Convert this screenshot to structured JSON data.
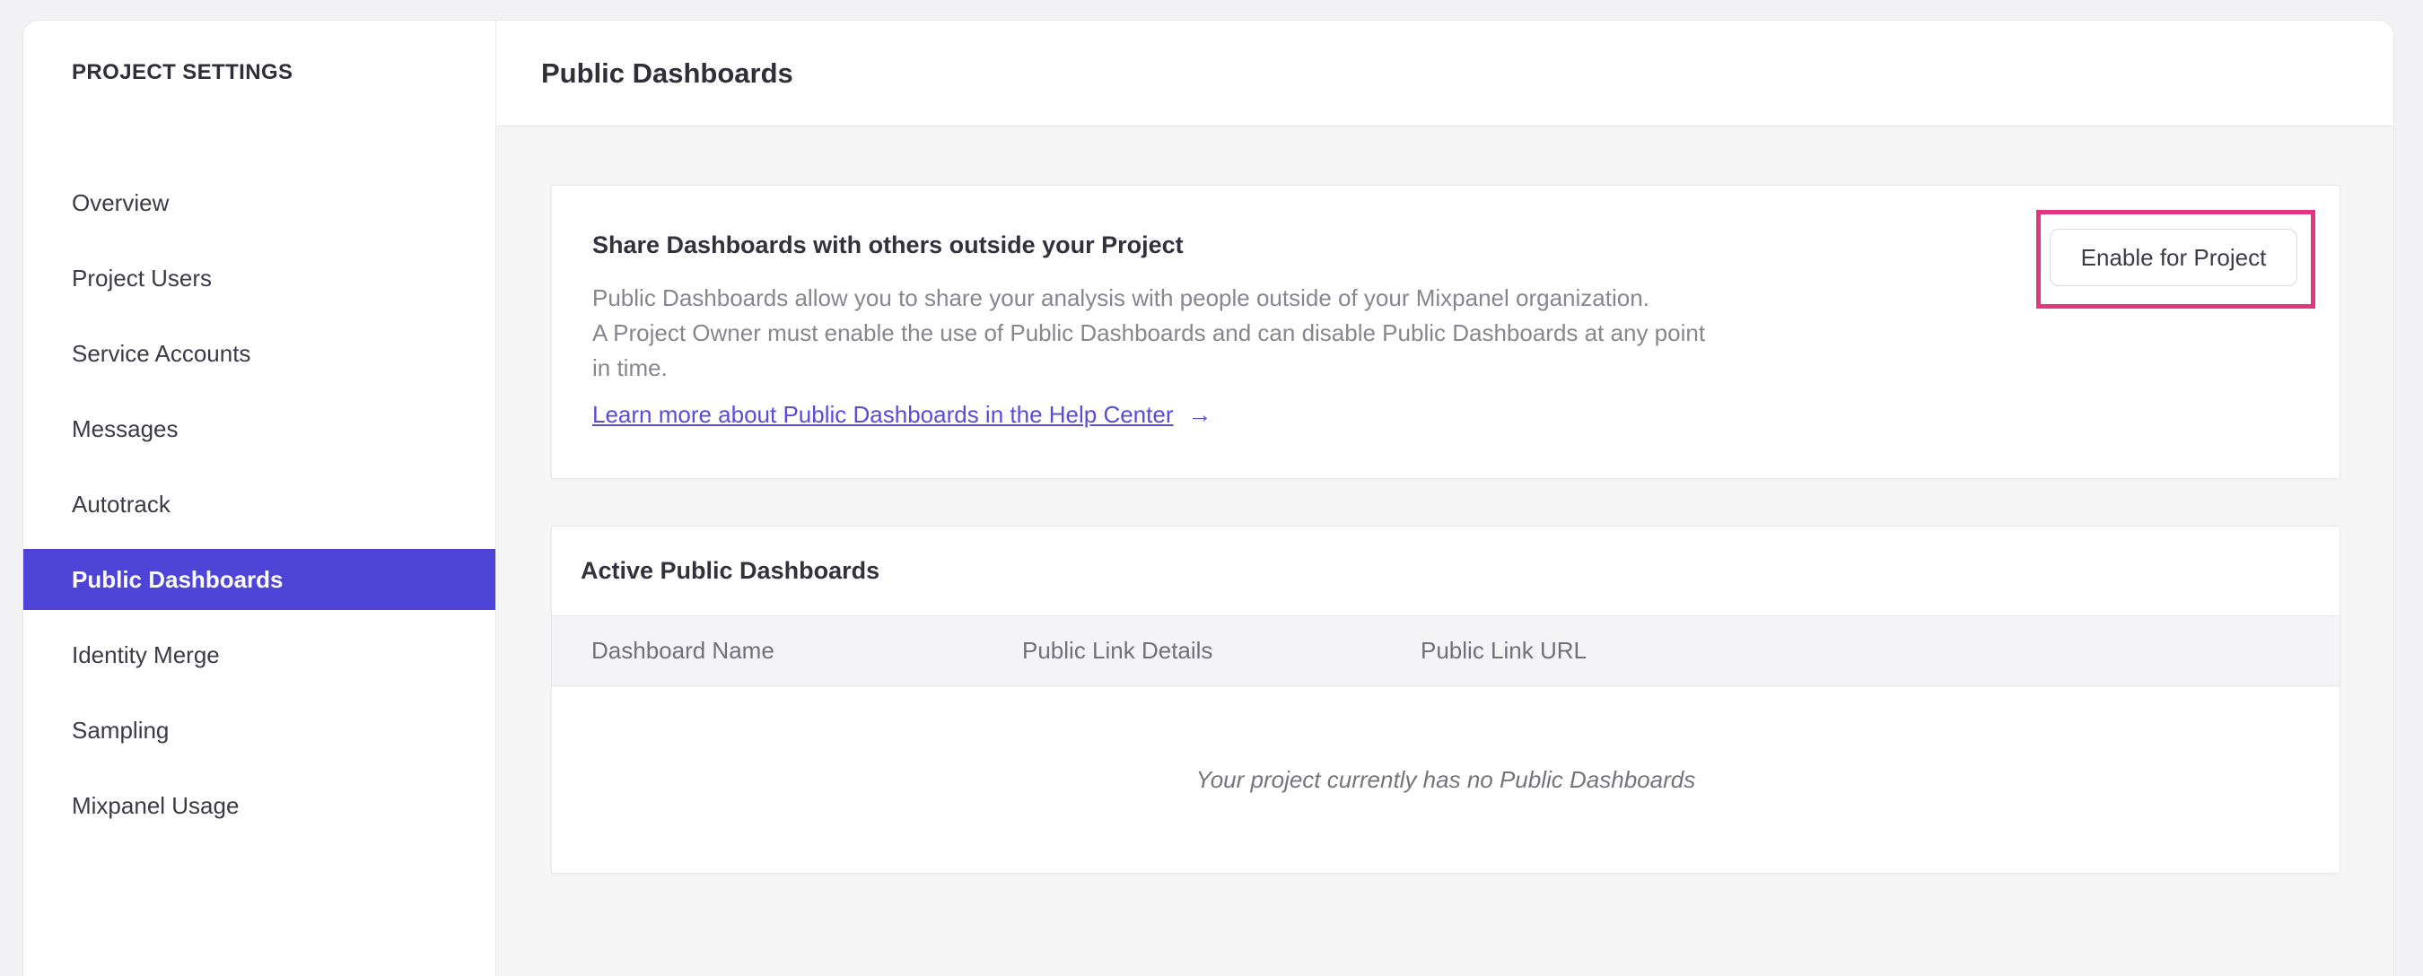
{
  "sidebar": {
    "title": "PROJECT SETTINGS",
    "items": [
      {
        "label": "Overview",
        "selected": false
      },
      {
        "label": "Project Users",
        "selected": false
      },
      {
        "label": "Service Accounts",
        "selected": false
      },
      {
        "label": "Messages",
        "selected": false
      },
      {
        "label": "Autotrack",
        "selected": false
      },
      {
        "label": "Public Dashboards",
        "selected": true
      },
      {
        "label": "Identity Merge",
        "selected": false
      },
      {
        "label": "Sampling",
        "selected": false
      },
      {
        "label": "Mixpanel Usage",
        "selected": false
      }
    ]
  },
  "header": {
    "title": "Public Dashboards"
  },
  "share_card": {
    "heading": "Share Dashboards with others outside your Project",
    "description_lines": [
      "Public Dashboards allow you to share your analysis with people outside of your Mixpanel organization.",
      "A Project Owner must enable the use of Public Dashboards and can disable Public Dashboards at any point",
      "in time."
    ],
    "link_label": "Learn more about Public Dashboards in the Help Center",
    "link_arrow": "→",
    "button_label": "Enable for Project"
  },
  "active_card": {
    "heading": "Active Public Dashboards",
    "columns": [
      "Dashboard Name",
      "Public Link Details",
      "Public Link URL"
    ],
    "empty_message": "Your project currently has no Public Dashboards"
  },
  "colors": {
    "selected_item_bg": "#4f44d8",
    "link_purple": "#5a4cd9",
    "annotation_pink": "#e23780",
    "content_bg": "#f5f5f6",
    "table_header_bg": "#f4f4f6"
  }
}
